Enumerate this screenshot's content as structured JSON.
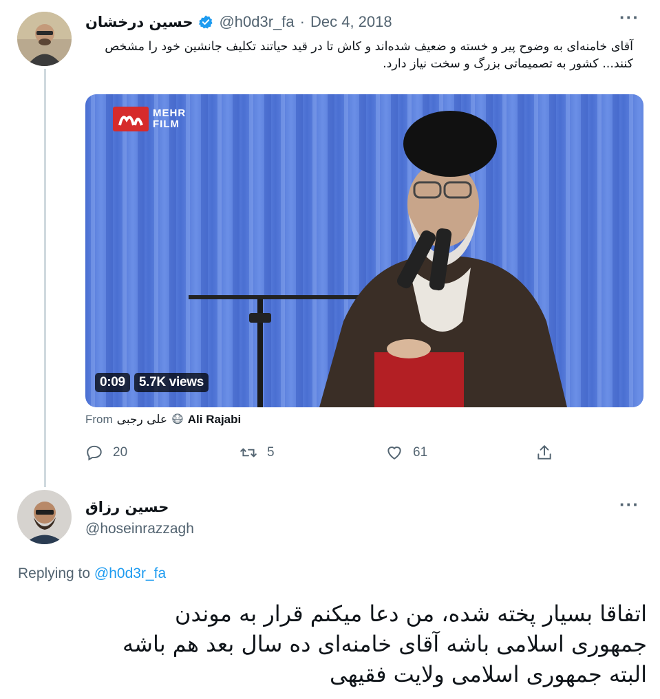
{
  "tweet": {
    "author_name": "حسین درخشان",
    "handle": "@h0d3r_fa",
    "date": "Dec 4, 2018",
    "text": "آقای خامنه‌ای به وضوح پیر و خسته و ضعیف شده‌اند و کاش تا در قید حیاتند تکلیف جانشین خود را مشخص کنند... کشور به تصمیماتی بزرگ و سخت نیاز دارد.",
    "media": {
      "watermark_line1": "MEHR",
      "watermark_line2": "FILM",
      "duration": "0:09",
      "views": "5.7K views"
    },
    "from_label": "From",
    "from_name_fa": "علی رجبی",
    "from_emoji": "😷",
    "from_name_en": "Ali Rajabi",
    "replies": "20",
    "retweets": "5",
    "likes": "61",
    "more_label": "···"
  },
  "reply": {
    "author_name": "حسین رزاق",
    "handle": "@hoseinrazzagh",
    "replying_to_label": "Replying to",
    "replying_to_handle": "@h0d3r_fa",
    "text": "اتفاقا بسیار پخته شده، من دعا میکنم قرار به موندن جمهوری اسلامی باشه آقای خامنه‌ای ده سال بعد هم باشه البته جمهوری اسلامی ولایت فقیهی",
    "more_label": "···"
  },
  "colors": {
    "accent": "#1d9bf0",
    "secondary_text": "#536471",
    "thread_line": "#cfd9de"
  }
}
